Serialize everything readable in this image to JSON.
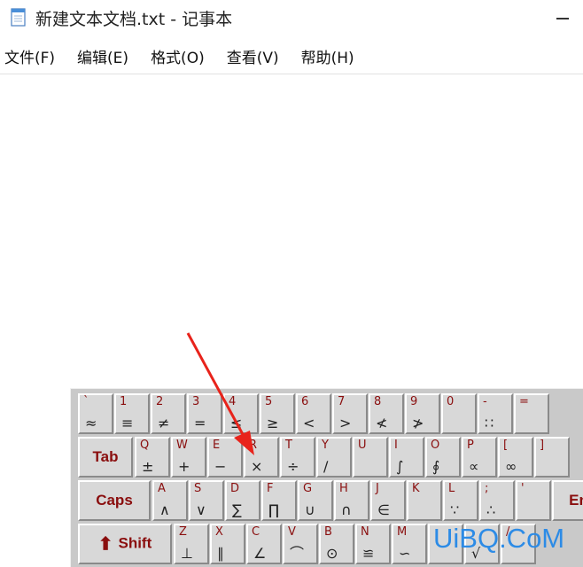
{
  "window": {
    "title": "新建文本文档.txt - 记事本",
    "icon": "notepad-document-icon"
  },
  "menu": [
    {
      "label": "文件(F)"
    },
    {
      "label": "编辑(E)"
    },
    {
      "label": "格式(O)"
    },
    {
      "label": "查看(V)"
    },
    {
      "label": "帮助(H)"
    }
  ],
  "keyboard": {
    "row1": [
      {
        "top": "`",
        "bot": "≈"
      },
      {
        "top": "1",
        "bot": "≡"
      },
      {
        "top": "2",
        "bot": "≠"
      },
      {
        "top": "3",
        "bot": "="
      },
      {
        "top": "4",
        "bot": "≤"
      },
      {
        "top": "5",
        "bot": "≥"
      },
      {
        "top": "6",
        "bot": "<"
      },
      {
        "top": "7",
        "bot": ">"
      },
      {
        "top": "8",
        "bot": "≮"
      },
      {
        "top": "9",
        "bot": "≯"
      },
      {
        "top": "0",
        "bot": ""
      },
      {
        "top": "-",
        "bot": "∷"
      },
      {
        "top": "=",
        "bot": ""
      }
    ],
    "row2_label": "Tab",
    "row2": [
      {
        "top": "Q",
        "bot": "±"
      },
      {
        "top": "W",
        "bot": "+"
      },
      {
        "top": "E",
        "bot": "−"
      },
      {
        "top": "R",
        "bot": "×"
      },
      {
        "top": "T",
        "bot": "÷"
      },
      {
        "top": "Y",
        "bot": "∕"
      },
      {
        "top": "U",
        "bot": ""
      },
      {
        "top": "I",
        "bot": "∫"
      },
      {
        "top": "O",
        "bot": "∮"
      },
      {
        "top": "P",
        "bot": "∝"
      },
      {
        "top": "[",
        "bot": "∞"
      },
      {
        "top": "]",
        "bot": ""
      }
    ],
    "row3_label": "Caps",
    "row3": [
      {
        "top": "A",
        "bot": "∧"
      },
      {
        "top": "S",
        "bot": "∨"
      },
      {
        "top": "D",
        "bot": "∑"
      },
      {
        "top": "F",
        "bot": "∏"
      },
      {
        "top": "G",
        "bot": "∪"
      },
      {
        "top": "H",
        "bot": "∩"
      },
      {
        "top": "J",
        "bot": "∈"
      },
      {
        "top": "K",
        "bot": ""
      },
      {
        "top": "L",
        "bot": "∵"
      },
      {
        "top": ";",
        "bot": "∴"
      },
      {
        "top": "'",
        "bot": ""
      }
    ],
    "row3_end": "En",
    "row4_label": "Shift",
    "row4": [
      {
        "top": "Z",
        "bot": "⊥"
      },
      {
        "top": "X",
        "bot": "∥"
      },
      {
        "top": "C",
        "bot": "∠"
      },
      {
        "top": "V",
        "bot": "⌒"
      },
      {
        "top": "B",
        "bot": "⊙"
      },
      {
        "top": "N",
        "bot": "≌"
      },
      {
        "top": "M",
        "bot": "∽"
      },
      {
        "top": "",
        "bot": ""
      },
      {
        "top": "",
        "bot": "√"
      },
      {
        "top": "/",
        "bot": ""
      }
    ]
  },
  "watermark": "UiBQ.CoM",
  "colors": {
    "key_top_text": "#8a0e0e",
    "arrow": "#e8231b",
    "watermark": "#2c8be6"
  }
}
